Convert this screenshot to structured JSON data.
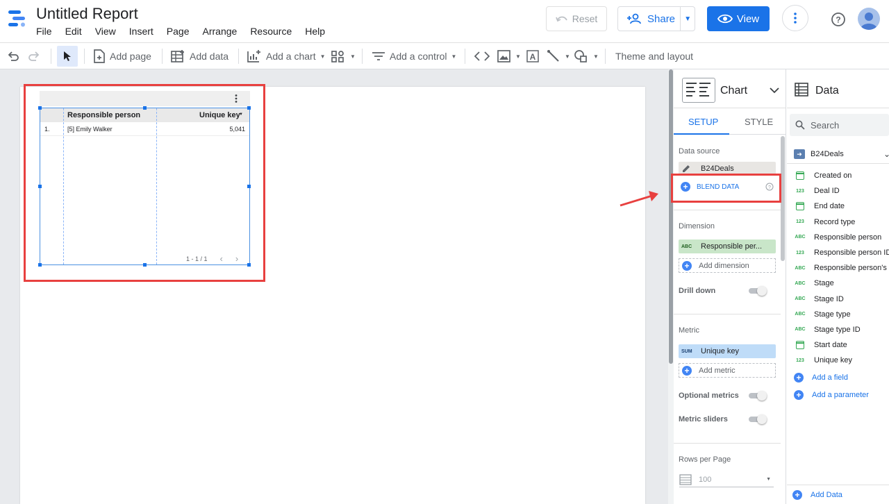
{
  "app": {
    "title": "Untitled Report"
  },
  "menu": [
    "File",
    "Edit",
    "View",
    "Insert",
    "Page",
    "Arrange",
    "Resource",
    "Help"
  ],
  "header": {
    "reset": "Reset",
    "share": "Share",
    "view": "View"
  },
  "toolbar": {
    "add_page": "Add page",
    "add_data": "Add data",
    "add_chart": "Add a chart",
    "add_control": "Add a control",
    "theme": "Theme and layout"
  },
  "table": {
    "columns": [
      "Responsible person",
      "Unique key"
    ],
    "rows": [
      {
        "index": "1.",
        "person": "[5] Emily Walker",
        "key": "5,041"
      }
    ],
    "pager": "1 - 1 / 1"
  },
  "props": {
    "title": "Chart",
    "tabs": [
      "SETUP",
      "STYLE"
    ],
    "data_source_label": "Data source",
    "data_source": "B24Deals",
    "blend": "BLEND DATA",
    "dimension_label": "Dimension",
    "dimension_type": "ABC",
    "dimension_value": "Responsible per...",
    "add_dimension": "Add dimension",
    "drill_down": "Drill down",
    "metric_label": "Metric",
    "metric_type": "SUM",
    "metric_value": "Unique key",
    "add_metric": "Add metric",
    "optional_metrics": "Optional metrics",
    "metric_sliders": "Metric sliders",
    "rows_per_page_label": "Rows per Page",
    "rows_per_page": "100"
  },
  "data_panel": {
    "title": "Data",
    "search_placeholder": "Search",
    "source": "B24Deals",
    "fields": [
      {
        "type": "date",
        "name": "Created on"
      },
      {
        "type": "123",
        "name": "Deal ID"
      },
      {
        "type": "date",
        "name": "End date"
      },
      {
        "type": "123",
        "name": "Record type"
      },
      {
        "type": "ABC",
        "name": "Responsible person"
      },
      {
        "type": "123",
        "name": "Responsible person ID"
      },
      {
        "type": "ABC",
        "name": "Responsible person's ..."
      },
      {
        "type": "ABC",
        "name": "Stage"
      },
      {
        "type": "ABC",
        "name": "Stage ID"
      },
      {
        "type": "ABC",
        "name": "Stage type"
      },
      {
        "type": "ABC",
        "name": "Stage type ID"
      },
      {
        "type": "date",
        "name": "Start date"
      },
      {
        "type": "123",
        "name": "Unique key"
      }
    ],
    "add_field": "Add a field",
    "add_parameter": "Add a parameter",
    "add_data": "Add Data"
  }
}
